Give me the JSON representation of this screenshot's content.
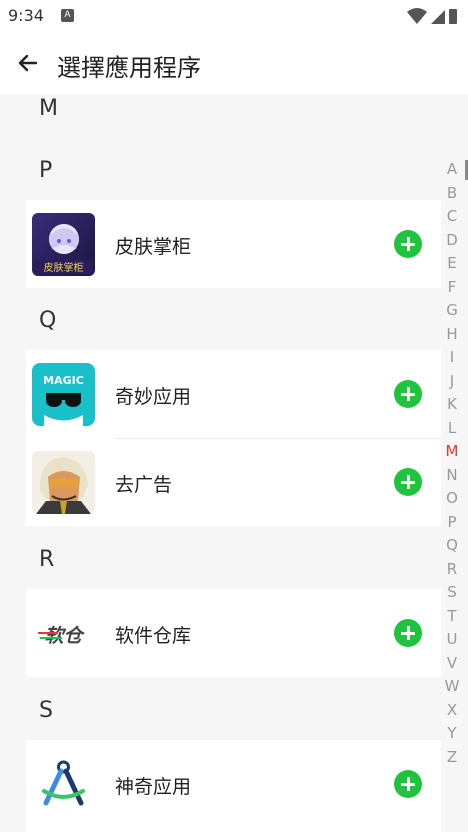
{
  "status": {
    "time": "9:34",
    "notification": "A"
  },
  "appbar": {
    "title": "選擇應用程序"
  },
  "sections": [
    {
      "letter": "M"
    },
    {
      "letter": "P",
      "items": [
        {
          "name": "皮肤掌柜",
          "icon": "skin-manager-app-icon"
        }
      ]
    },
    {
      "letter": "Q",
      "items": [
        {
          "name": "奇妙应用",
          "icon": "magic-app-icon"
        },
        {
          "name": "去广告",
          "icon": "ad-remover-app-icon"
        }
      ]
    },
    {
      "letter": "R",
      "items": [
        {
          "name": "软件仓库",
          "icon": "software-repo-app-icon"
        }
      ]
    },
    {
      "letter": "S",
      "items": [
        {
          "name": "神奇应用",
          "icon": "compass-app-icon"
        }
      ]
    }
  ],
  "app_icon_texts": {
    "skin": "皮肤掌柜",
    "magic": "MAGIC",
    "repo": "软仓"
  },
  "index": [
    "A",
    "B",
    "C",
    "D",
    "E",
    "F",
    "G",
    "H",
    "I",
    "J",
    "K",
    "L",
    "M",
    "N",
    "O",
    "P",
    "Q",
    "R",
    "S",
    "T",
    "U",
    "V",
    "W",
    "X",
    "Y",
    "Z"
  ],
  "index_active": "M",
  "colors": {
    "add_button": "#1ec43d",
    "index_active": "#e53935",
    "magic_bg": "#19c0c9"
  }
}
